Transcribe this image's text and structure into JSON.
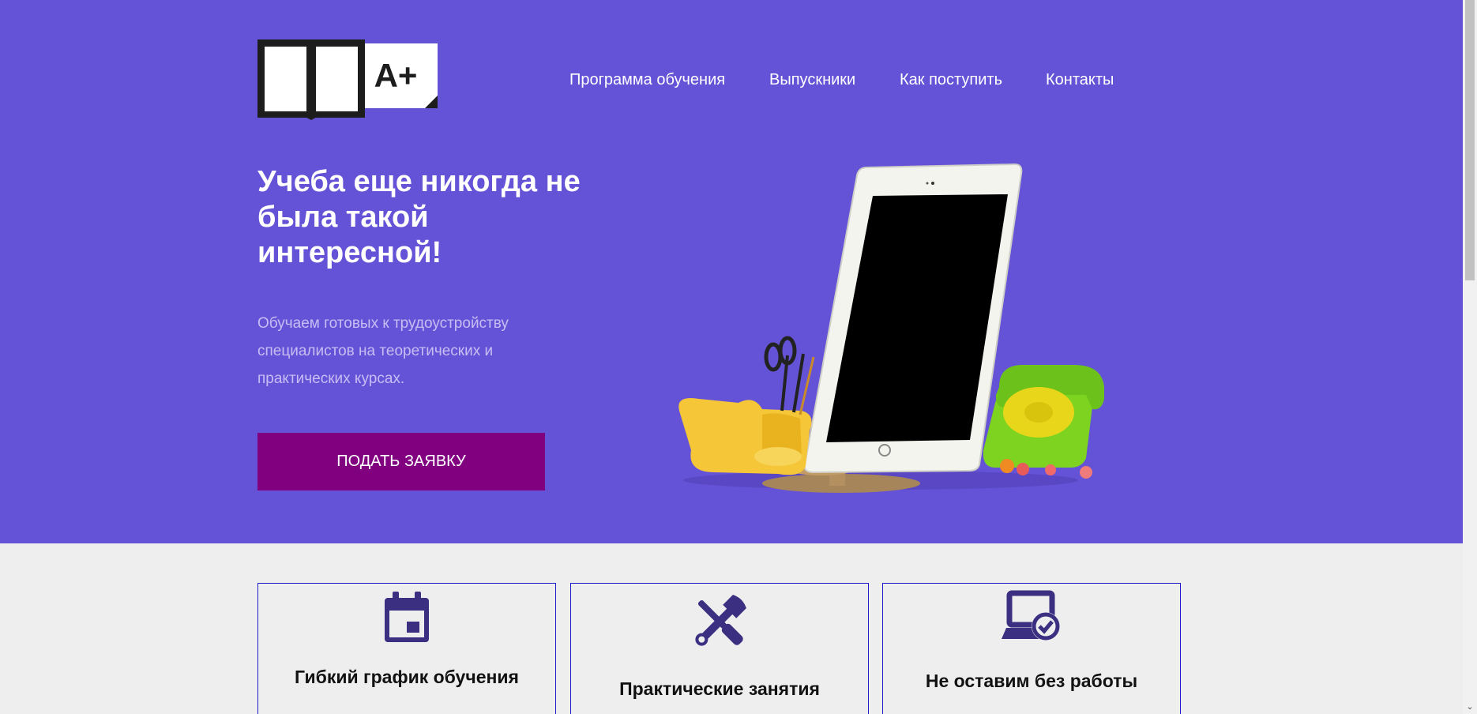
{
  "header": {
    "logo_text": "A+",
    "nav": [
      "Программа обучения",
      "Выпускники",
      "Как поступить",
      "Контакты"
    ]
  },
  "hero": {
    "title": "Учеба еще никогда не была такой интересной!",
    "subtitle": "Обучаем готовых к трудоустройству специалистов на теоретических и практических курсах.",
    "cta_label": "ПОДАТЬ ЗАЯВКУ",
    "colors": {
      "background": "#6553d7",
      "cta": "#800080"
    }
  },
  "features": [
    {
      "icon": "calendar-icon",
      "title": "Гибкий график обучения"
    },
    {
      "icon": "tools-icon",
      "title": "Практические занятия"
    },
    {
      "icon": "laptop-check-icon",
      "title": "Не оставим без работы"
    }
  ],
  "scrollbar": {
    "arrow": "⌄"
  }
}
